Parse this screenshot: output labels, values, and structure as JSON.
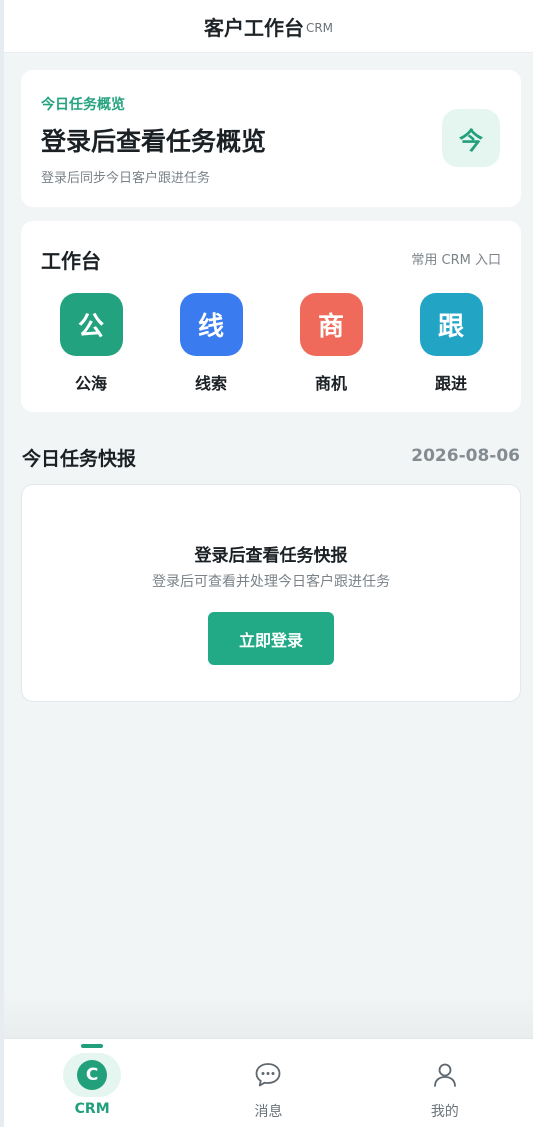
{
  "header": {
    "title": "客户工作台",
    "subtitle": "CRM"
  },
  "overview": {
    "tag": "今日任务概览",
    "title": "登录后查看任务概览",
    "subtitle": "登录后同步今日客户跟进任务",
    "badge": "今"
  },
  "workbench": {
    "title": "工作台",
    "hint": "常用 CRM 入口",
    "items": [
      {
        "glyph": "公",
        "label": "公海",
        "color": "#23a27f"
      },
      {
        "glyph": "线",
        "label": "线索",
        "color": "#3a7bef"
      },
      {
        "glyph": "商",
        "label": "商机",
        "color": "#ef6a5b"
      },
      {
        "glyph": "跟",
        "label": "跟进",
        "color": "#22a5c5"
      }
    ]
  },
  "report": {
    "section_title": "今日任务快报",
    "date": "2026-08-06",
    "title": "登录后查看任务快报",
    "subtitle": "登录后可查看并处理今日客户跟进任务",
    "login_button": "立即登录"
  },
  "tabbar": {
    "tabs": [
      {
        "glyph": "C",
        "label": "CRM",
        "icon": "crm-icon",
        "active": true
      },
      {
        "label": "消息",
        "icon": "chat-bubble-icon",
        "active": false
      },
      {
        "label": "我的",
        "icon": "user-icon",
        "active": false
      }
    ]
  },
  "colors": {
    "accent": "#22a07b",
    "page_bg": "#f2f5f6"
  }
}
